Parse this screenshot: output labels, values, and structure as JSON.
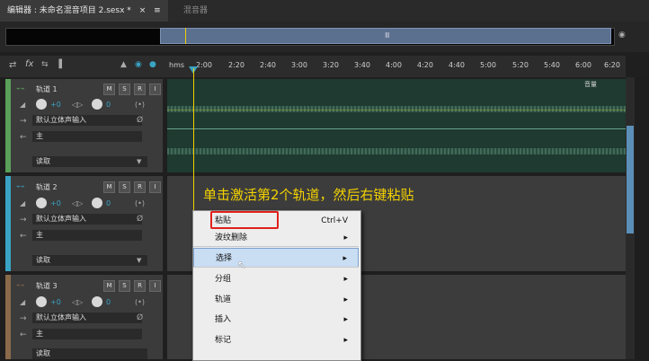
{
  "tabs": [
    {
      "label": "编辑器 : 未命名混音项目 2.sesx *",
      "active": true
    },
    {
      "label": "混音器",
      "active": false
    }
  ],
  "ruler": {
    "labels": [
      "hms",
      "2:00",
      "2:20",
      "2:40",
      "3:00",
      "3:20",
      "3:40",
      "4:00",
      "4:20",
      "4:40",
      "5:00",
      "5:20",
      "5:40",
      "6:00",
      "6:20"
    ]
  },
  "tracks": [
    {
      "name": "轨道 1",
      "volume": "+0",
      "input": "默认立体声输入",
      "output": "主",
      "mode": "读取",
      "color": "#5aa05a"
    },
    {
      "name": "轨道 2",
      "volume": "+0",
      "input": "默认立体声输入",
      "output": "主",
      "mode": "读取",
      "color": "#3aa3c4"
    },
    {
      "name": "轨道 3",
      "volume": "+0",
      "input": "默认立体声输入",
      "output": "主",
      "mode": "读取",
      "color": "#8a6a4a"
    }
  ],
  "track_buttons": {
    "m": "M",
    "s": "S",
    "r": "R",
    "i": "I"
  },
  "lane1_label": "音量",
  "annotation": "单击激活第2个轨道，然后右键粘贴",
  "context_menu": [
    {
      "label": "粘贴",
      "shortcut": "Ctrl+V",
      "submenu": false
    },
    {
      "label": "波纹删除",
      "shortcut": "",
      "submenu": true
    },
    {
      "label": "选择",
      "shortcut": "",
      "submenu": true,
      "highlighted": true
    },
    {
      "label": "分组",
      "shortcut": "",
      "submenu": true
    },
    {
      "label": "轨道",
      "shortcut": "",
      "submenu": true
    },
    {
      "label": "插入",
      "shortcut": "",
      "submenu": true
    },
    {
      "label": "标记",
      "shortcut": "",
      "submenu": true
    }
  ],
  "icons": {
    "close": "×",
    "menu": "≡",
    "fx": "fx",
    "submenu_arrow": "▸",
    "dropdown": "▼"
  }
}
